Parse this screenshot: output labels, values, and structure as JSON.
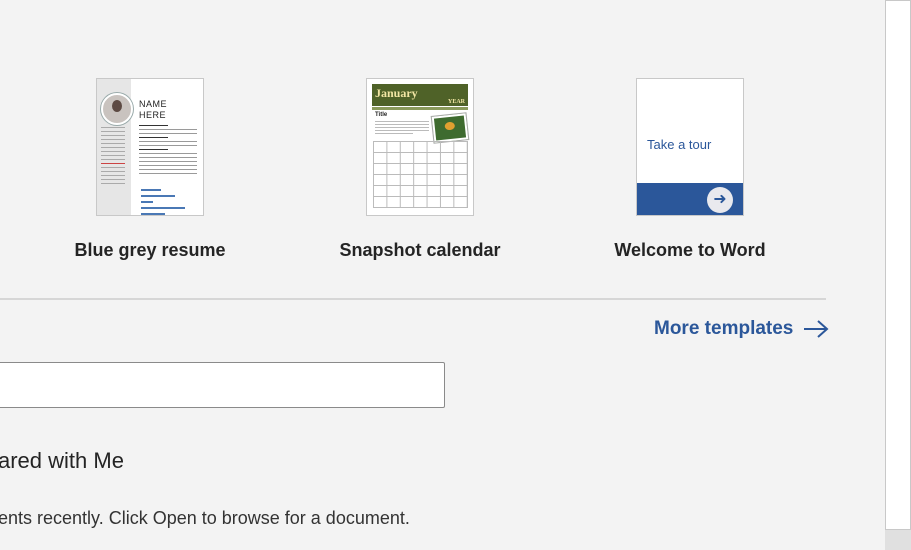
{
  "templates": [
    {
      "label": "Blue grey resume",
      "thumb_name": "NAME",
      "thumb_name2": "HERE"
    },
    {
      "label": "Snapshot calendar",
      "thumb_month": "January",
      "thumb_year": "YEAR",
      "thumb_title": "Title"
    },
    {
      "label": "Welcome to Word",
      "thumb_text": "Take a tour"
    }
  ],
  "more_templates": {
    "label": "More templates",
    "icon": "arrow-right-icon"
  },
  "search": {
    "value": "",
    "placeholder": ""
  },
  "shared_tab": {
    "label": "ared with Me"
  },
  "empty_message": "ents recently. Click Open to browse for a document.",
  "colors": {
    "accent": "#2b579a",
    "background": "#f3f3f3",
    "calendar_header": "#4f6228"
  }
}
